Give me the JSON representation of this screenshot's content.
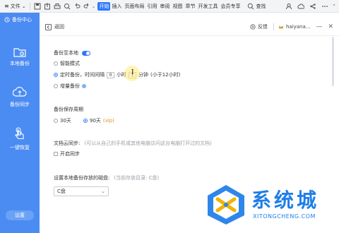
{
  "menubar": {
    "file_label": "文件",
    "tabs": [
      "开始",
      "插入",
      "页面布局",
      "引用",
      "审阅",
      "视图",
      "章节",
      "开发工具",
      "会员专享"
    ],
    "active_tab": "开始",
    "search_label": "查找"
  },
  "sidebar": {
    "title": "备份中心",
    "items": [
      {
        "label": "本地备份",
        "icon": "folder-icon"
      },
      {
        "label": "备份同步",
        "icon": "cloud-upload-icon"
      },
      {
        "label": "一键恢复",
        "icon": "hand-tap-icon"
      }
    ],
    "settings_label": "设置"
  },
  "header": {
    "back_label": "返回",
    "feedback_label": "反馈",
    "user_name": "haiyana..."
  },
  "local_backup": {
    "label": "备份至本地",
    "enabled": true,
    "options": {
      "smart": "智能模式",
      "timed_prefix": "定时备份，时间间隔",
      "hours_value": "0",
      "hours_unit": "小时",
      "minutes_value": "1",
      "minutes_unit": "分钟",
      "timed_note": "(小于12小时)",
      "incremental": "增量备份"
    },
    "selected": "timed"
  },
  "retention": {
    "label": "备份保存周期",
    "option_30": "30天",
    "option_90": "90天",
    "vip_tag": "(vip)",
    "selected": "90"
  },
  "cloud_sync": {
    "label": "文档云同步:",
    "desc": "(可以从自己的手机或其他电脑访问这台电脑打开过的文档)",
    "toggle_label": "开启同步"
  },
  "disk": {
    "label": "设置本地备份存放的磁盘:",
    "current": "(当前存放目录: C盘)",
    "value": "C盘"
  },
  "watermark": {
    "text": "系统城",
    "url": "XITONGCHENG.COM"
  },
  "colors": {
    "accent": "#2f78ff",
    "sidebar": "#4b8cf2",
    "watermark": "#1e7ee8"
  }
}
